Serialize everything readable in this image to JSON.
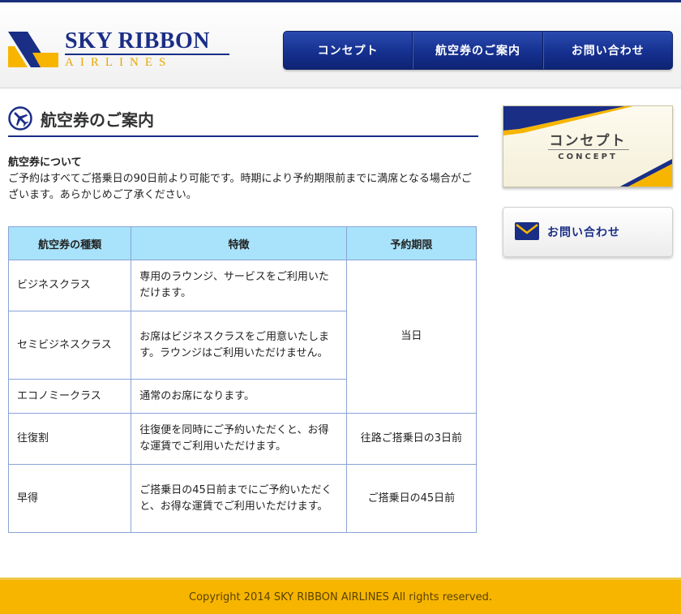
{
  "brand": {
    "name_top": "SKY RIBBON",
    "name_bottom": "AIRLINES",
    "colors": {
      "navy": "#1a2e86",
      "gold": "#f7b500",
      "table_header": "#a8e3fb"
    }
  },
  "global_nav": {
    "items": [
      {
        "label": "コンセプト"
      },
      {
        "label": "航空券のご案内"
      },
      {
        "label": "お問い合わせ"
      }
    ]
  },
  "page": {
    "title": "航空券のご案内",
    "title_icon": "airplane-icon",
    "intro_heading": "航空券について",
    "intro_text": "ご予約はすべてご搭乗日の90日前より可能です。時期により予約期限前までに満席となる場合がございます。あらかじめご了承ください。"
  },
  "fare_table": {
    "headers": [
      "航空券の種類",
      "特徴",
      "予約期限"
    ],
    "rows": [
      {
        "type": "ビジネスクラス",
        "feature": "専用のラウンジ、サービスをご利用いただけます。"
      },
      {
        "type": "セミビジネスクラス",
        "feature": "お席はビジネスクラスをご用意いたします。ラウンジはご利用いただけません。"
      },
      {
        "type": "エコノミークラス",
        "feature": "通常のお席になります。"
      },
      {
        "type": "往復割",
        "feature": "往復便を同時にご予約いただくと、お得な運賃でご利用いただけます。",
        "deadline": "往路ご搭乗日の3日前"
      },
      {
        "type": "早得",
        "feature": "ご搭乗日の45日前までにご予約いただくと、お得な運賃でご利用いただけます。",
        "deadline": "ご搭乗日の45日前"
      }
    ],
    "shared_deadline": "当日"
  },
  "sidebar": {
    "concept_banner": {
      "label_jp": "コンセプト",
      "label_en": "CONCEPT"
    },
    "contact_banner": {
      "label": "お問い合わせ",
      "icon": "envelope-icon"
    }
  },
  "footer": {
    "copyright": "Copyright 2014 SKY RIBBON AIRLINES All rights reserved."
  }
}
